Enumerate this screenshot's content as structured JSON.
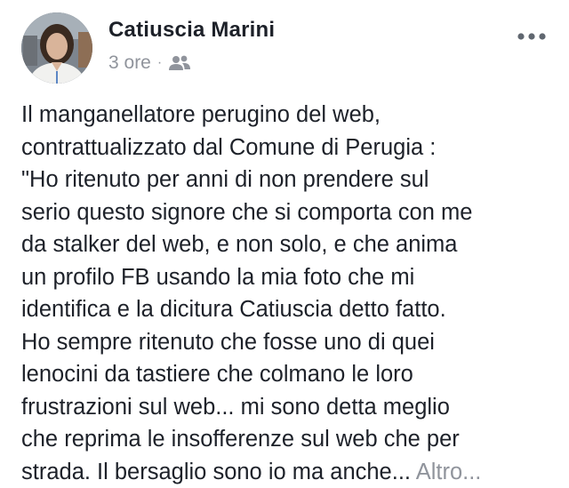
{
  "post": {
    "author_name": "Catiuscia Marini",
    "timestamp": "3 ore",
    "separator": "·",
    "audience_icon": "friends-icon",
    "more_icon": "more-options-icon",
    "body_lines": [
      "Il manganellatore perugino del web,",
      "contrattualizzato dal Comune di Perugia :",
      "\"Ho ritenuto per anni di non prendere sul",
      "serio questo signore che si comporta con me",
      "da stalker del web, e non solo, e che anima",
      "un profilo FB usando la mia foto che mi",
      "identifica e la dicitura Catiuscia detto fatto.",
      "Ho sempre ritenuto che fosse uno di quei",
      "lenocini da tastiere che colmano le loro",
      "frustrazioni sul web... mi sono detta meglio",
      "che reprima le insofferenze sul web che per",
      "strada. Il bersaglio sono io ma anche..."
    ],
    "see_more_label": "Altro..."
  },
  "colors": {
    "text": "#1d2129",
    "secondary": "#90949c"
  }
}
